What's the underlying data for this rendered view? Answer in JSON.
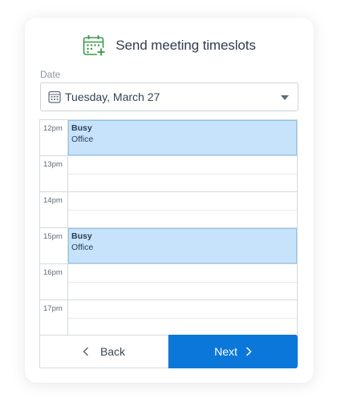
{
  "header": {
    "title": "Send meeting timeslots",
    "icon": "calendar-add-icon"
  },
  "date_field": {
    "label": "Date",
    "value": "Tuesday, March 27",
    "icon": "calendar-icon"
  },
  "schedule": {
    "hours": [
      "12pm",
      "13pm",
      "14pm",
      "15pm",
      "16pm",
      "17pm"
    ],
    "events": [
      {
        "title": "Busy",
        "subtitle": "Office",
        "start_hour": "12pm"
      },
      {
        "title": "Busy",
        "subtitle": "Office",
        "start_hour": "15pm"
      }
    ]
  },
  "footer": {
    "back_label": "Back",
    "next_label": "Next"
  },
  "colors": {
    "accent": "#0b77d9",
    "event_fill": "#c6e3fb",
    "event_border": "#8ec4ee",
    "icon_green": "#3a9a4a"
  }
}
